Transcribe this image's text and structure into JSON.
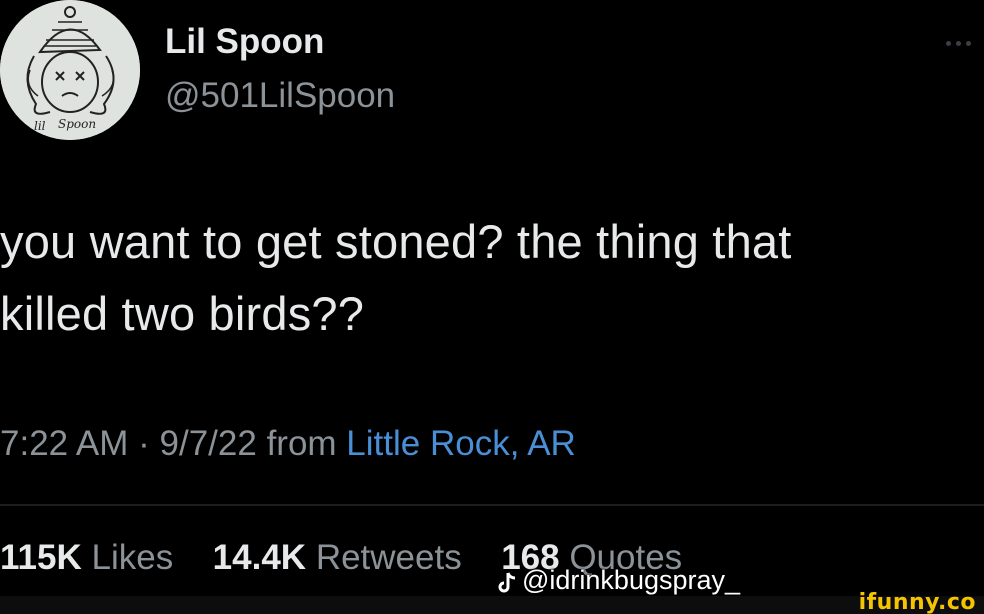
{
  "author": {
    "display_name": "Lil Spoon",
    "handle": "@501LilSpoon",
    "avatar_caption": "lil Spoon"
  },
  "tweet": {
    "text": "you want to get stoned? the thing that\nkilled two birds??",
    "time": "7:22 AM",
    "separator": " · ",
    "date": "9/7/22",
    "from_label": " from ",
    "location": "Little Rock, AR"
  },
  "stats": {
    "likes_count": "115K",
    "likes_label": "Likes",
    "retweets_count": "14.4K",
    "retweets_label": "Retweets",
    "quotes_count": "168",
    "quotes_label": "Quotes"
  },
  "watermarks": {
    "tiktok_handle": "@idrinkbugspray_",
    "ifunny": "ifunny.co"
  },
  "colors": {
    "background": "#000000",
    "text_primary": "#e7e9ea",
    "text_secondary": "#8b9298",
    "link": "#4a8fd6",
    "ifunny_yellow": "#f5c400"
  },
  "icons": {
    "more": "more-dots-icon",
    "tiktok": "tiktok-icon"
  }
}
